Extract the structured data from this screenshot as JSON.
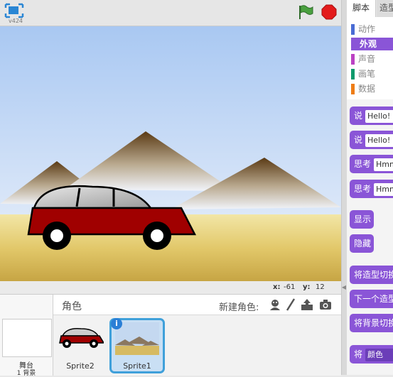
{
  "app": {
    "version": "v424",
    "icons": {
      "present": "fullscreen-icon",
      "flag": "green-flag-icon",
      "stop": "stop-icon"
    },
    "colors": {
      "looks_category": "#8a55d7",
      "selected_sprite_border": "#3fa0da"
    }
  },
  "stage": {
    "coords": {
      "x_label": "x:",
      "x": "-61",
      "y_label": "y:",
      "y": "12"
    }
  },
  "library": {
    "title": "角色",
    "new_sprite_label": "新建角色:",
    "new_sprite_icons": [
      "sprite-library-icon",
      "paint-icon",
      "upload-icon",
      "camera-icon"
    ],
    "stage_pane": {
      "label": "舞台",
      "count": "1 背景"
    },
    "sprites": [
      {
        "name": "Sprite2",
        "selected": false
      },
      {
        "name": "Sprite1",
        "selected": true,
        "info": "i"
      }
    ]
  },
  "tabs": {
    "scripts": "脚本",
    "costumes": "造型"
  },
  "categories": [
    {
      "label": "动作",
      "color": "#4a6cd4",
      "active": false
    },
    {
      "label": "外观",
      "color": "#8a55d7",
      "active": true
    },
    {
      "label": "声音",
      "color": "#bb42c3",
      "active": false
    },
    {
      "label": "画笔",
      "color": "#0e9a6c",
      "active": false
    },
    {
      "label": "数据",
      "color": "#ee7d16",
      "active": false
    }
  ],
  "blocks": [
    {
      "label": "说",
      "input": "Hello!"
    },
    {
      "label": "说",
      "input": "Hello!"
    },
    {
      "label": "思考",
      "input": "Hmm..."
    },
    {
      "label": "思考",
      "input": "Hmm..."
    },
    {
      "label": "显示",
      "input": ""
    },
    {
      "label": "隐藏",
      "input": ""
    },
    {
      "label": "将造型切换为",
      "input": ""
    },
    {
      "label": "下一个造型",
      "input": ""
    },
    {
      "label": "将背景切换为",
      "input": ""
    },
    {
      "label": "将",
      "input": "颜色"
    }
  ]
}
